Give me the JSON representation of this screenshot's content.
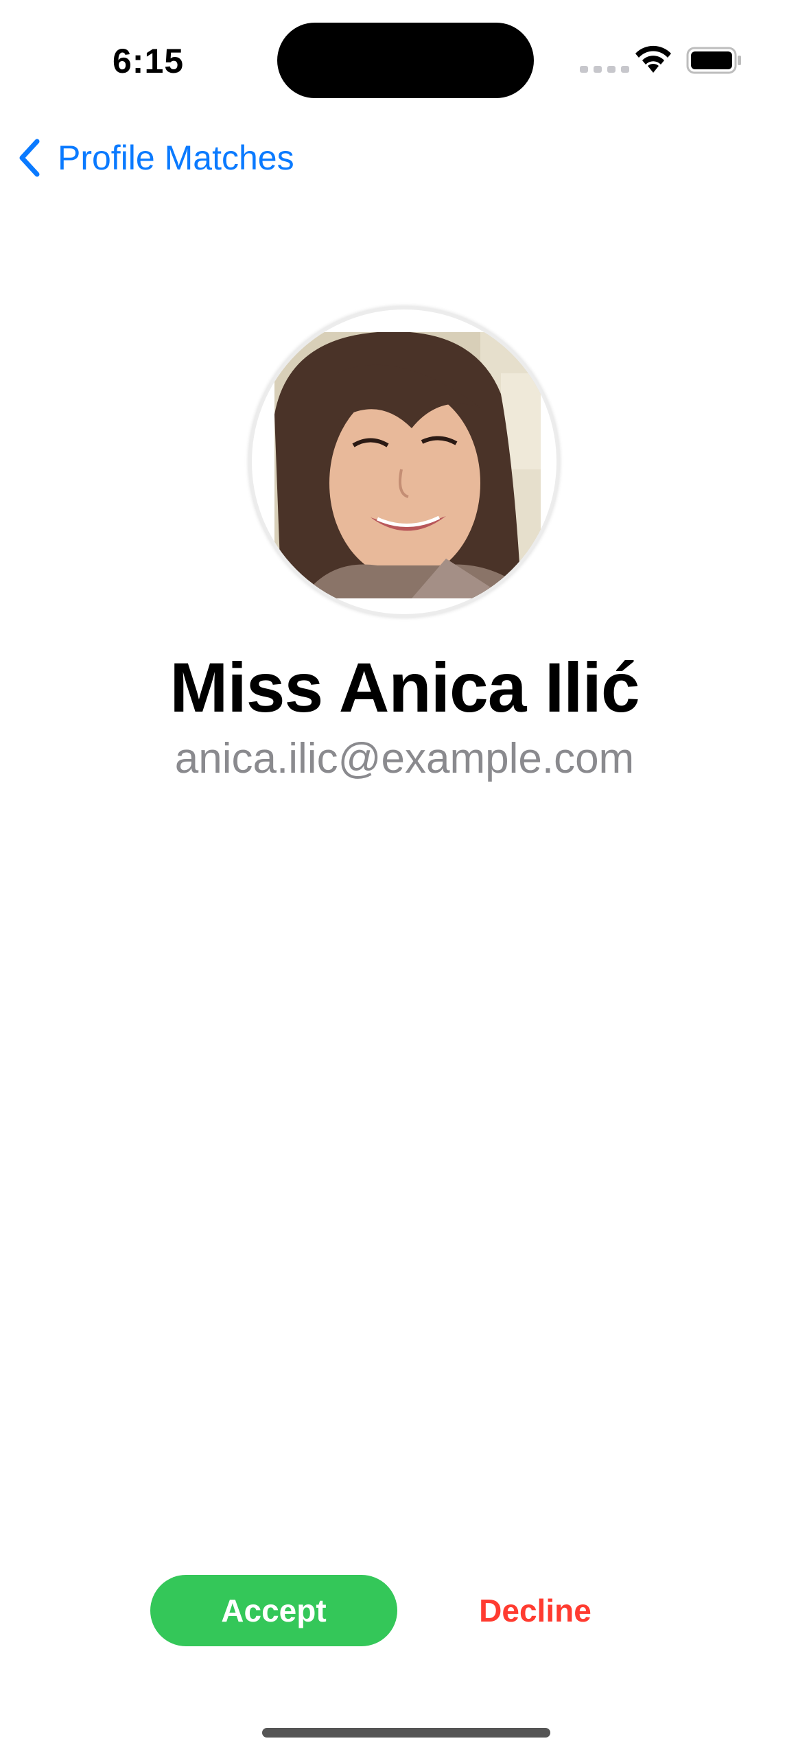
{
  "status_bar": {
    "time": "6:15"
  },
  "nav": {
    "back_label": "Profile Matches"
  },
  "profile": {
    "name": "Miss Anica Ilić",
    "email": "anica.ilic@example.com"
  },
  "actions": {
    "accept_label": "Accept",
    "decline_label": "Decline"
  },
  "colors": {
    "accent": "#0a7aff",
    "accept": "#34c759",
    "decline": "#ff3b30",
    "secondary_text": "#8a8a8e"
  }
}
